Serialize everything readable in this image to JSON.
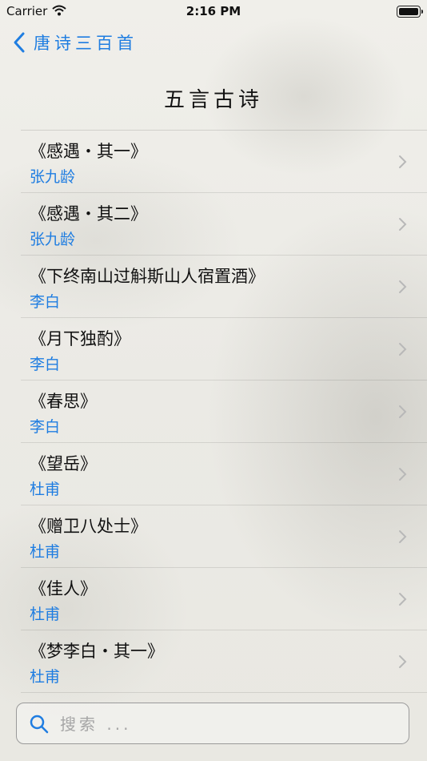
{
  "status_bar": {
    "carrier": "Carrier",
    "time": "2:16 PM"
  },
  "nav": {
    "back_label": "唐诗三百首"
  },
  "section_title": "五言古诗",
  "poems": [
    {
      "title": "《感遇・其一》",
      "author": "张九龄"
    },
    {
      "title": "《感遇・其二》",
      "author": "张九龄"
    },
    {
      "title": "《下终南山过斛斯山人宿置酒》",
      "author": "李白"
    },
    {
      "title": "《月下独酌》",
      "author": "李白"
    },
    {
      "title": "《春思》",
      "author": "李白"
    },
    {
      "title": "《望岳》",
      "author": "杜甫"
    },
    {
      "title": "《赠卫八处士》",
      "author": "杜甫"
    },
    {
      "title": "《佳人》",
      "author": "杜甫"
    },
    {
      "title": "《梦李白・其一》",
      "author": "杜甫"
    }
  ],
  "search": {
    "placeholder": "搜索 ...",
    "value": ""
  },
  "colors": {
    "accent": "#1f7de1",
    "text": "#111111"
  },
  "icons": {
    "back": "chevron-left-icon",
    "row": "chevron-right-icon",
    "search": "magnifier-icon",
    "wifi": "wifi-icon",
    "battery": "battery-icon"
  }
}
